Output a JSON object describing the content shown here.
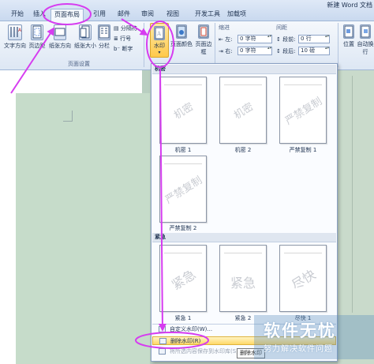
{
  "window": {
    "title": "新建 Word 文档"
  },
  "tabs": [
    {
      "label": "开始"
    },
    {
      "label": "插入"
    },
    {
      "label": "页面布局"
    },
    {
      "label": "引用"
    },
    {
      "label": "邮件"
    },
    {
      "label": "审阅"
    },
    {
      "label": "视图"
    },
    {
      "label": "开发工具"
    },
    {
      "label": "加载项"
    }
  ],
  "ribbon": {
    "page_setup": {
      "text_direction": "文字方向",
      "margins": "页边距",
      "orientation": "纸张方向",
      "size": "纸张大小",
      "columns": "分栏",
      "breaks": "分隔符",
      "line_numbers": "行号",
      "hyphenation": "断字",
      "group_label": "页面设置"
    },
    "page_background": {
      "watermark": "水印",
      "page_color": "页面颜色",
      "page_borders": "页面边框"
    },
    "paragraph": {
      "indent_label": "缩进",
      "indent_left_label": "左:",
      "indent_left_value": "0 字符",
      "indent_right_label": "右:",
      "indent_right_value": "0 字符",
      "spacing_label": "间距",
      "spacing_before_label": "段前:",
      "spacing_before_value": "0 行",
      "spacing_after_label": "段后:",
      "spacing_after_value": "10 磅"
    },
    "arrange": {
      "position": "位置",
      "text_wrap": "自动换行"
    }
  },
  "gallery": {
    "section_confidential": "机密",
    "section_urgent": "紧急",
    "items_confidential": [
      {
        "caption": "机密 1",
        "watermark_text": "机密"
      },
      {
        "caption": "机密 2",
        "watermark_text": "机密"
      },
      {
        "caption": "严禁复制 1",
        "watermark_text": "严禁复制"
      },
      {
        "caption": "严禁复制 2",
        "watermark_text": "严禁复制"
      }
    ],
    "items_urgent": [
      {
        "caption": "紧急 1",
        "watermark_text": "紧急"
      },
      {
        "caption": "紧急 2",
        "watermark_text": "紧急"
      },
      {
        "caption": "尽快 1",
        "watermark_text": "尽快"
      }
    ],
    "menu": {
      "custom_watermark": "自定义水印(W)...",
      "remove_watermark": "删除水印(R)",
      "save_selection": "将所选内容保存到水印库(S)..."
    }
  },
  "tooltip": {
    "text": "删除水印"
  },
  "logo": {
    "title": "软件无忧",
    "subtitle": "努力解决软件问题"
  },
  "colors": {
    "annotation": "#d63cf0",
    "highlight": "#ffd867",
    "ribbon": "#dde7f4",
    "document_background": "#c6dcca"
  }
}
